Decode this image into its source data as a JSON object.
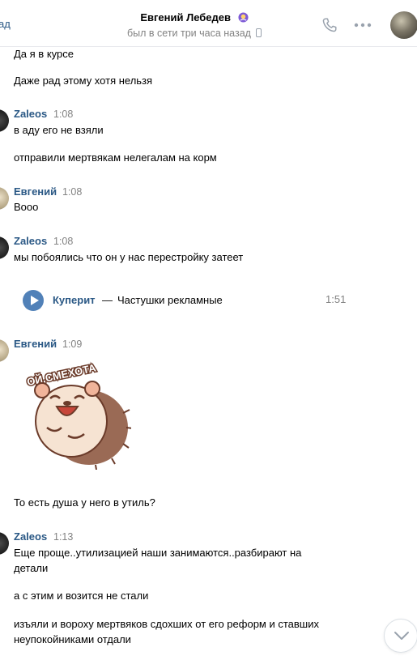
{
  "header": {
    "back_label": "ад",
    "contact_name": "Евгений Лебедев",
    "status": "был в сети три часа назад"
  },
  "messages": [
    {
      "id": "m1",
      "text": "Да я в курсе"
    },
    {
      "id": "m2",
      "text": "Даже рад этому хотя нельзя"
    },
    {
      "id": "g1",
      "author": "Zaleos",
      "time": "1:08"
    },
    {
      "id": "m3",
      "text": "в аду его не взяли"
    },
    {
      "id": "m4",
      "text": "отправили мертвякам нелегалам на корм"
    },
    {
      "id": "g2",
      "author": "Евгений",
      "time": "1:08"
    },
    {
      "id": "m5",
      "text": "Вооо"
    },
    {
      "id": "g3",
      "author": "Zaleos",
      "time": "1:08"
    },
    {
      "id": "m6",
      "text": "мы побоялись что он у нас перестройку затеет"
    },
    {
      "id": "g4",
      "author": "Евгений",
      "time": "1:09"
    },
    {
      "id": "m7",
      "text": "То есть душа у него в утиль?"
    },
    {
      "id": "g5",
      "author": "Zaleos",
      "time": "1:13"
    },
    {
      "id": "m8a",
      "text": "Еще проще..утилизацией наши занимаются..разбирают на"
    },
    {
      "id": "m8b",
      "text": "детали"
    },
    {
      "id": "m9",
      "text": "а с этим и возится не стали"
    },
    {
      "id": "m10a",
      "text": "изъяли и вороху мертвяков сдохших от его реформ и ставших"
    },
    {
      "id": "m10b",
      "text": "неупокойниками отдали"
    }
  ],
  "audio": {
    "artist": "Куперит",
    "separator": "—",
    "title": "Частушки рекламные",
    "duration": "1:51"
  },
  "sticker": {
    "caption": "ОЙ,СМЕХОТА",
    "icon": "hedgehog-laughing-sticker"
  },
  "colors": {
    "link": "#2a5885",
    "muted": "#828282",
    "accent": "#5181b8"
  }
}
